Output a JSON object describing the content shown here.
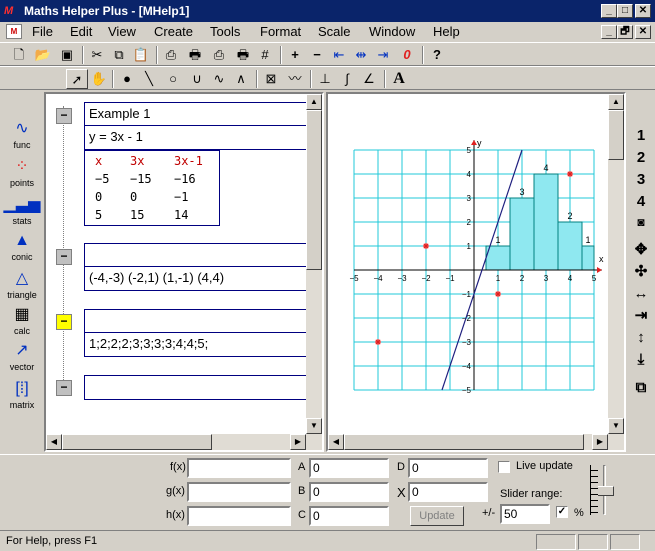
{
  "window": {
    "title": "Maths Helper Plus - [MHelp1]",
    "app_icon": "M",
    "minimize": "_",
    "maximize": "□",
    "close": "✕",
    "restore": "🗗"
  },
  "menu": {
    "items": [
      "File",
      "Edit",
      "View",
      "Create",
      "Tools",
      "Format",
      "Scale",
      "Window",
      "Help"
    ]
  },
  "toolbar1": {
    "icons": [
      "new-document-icon",
      "open-folder-icon",
      "save-icon",
      "cut-icon",
      "copy-icon",
      "paste-icon",
      "print-icon",
      "print-preview-icon",
      "print-graph-icon",
      "print-notes-icon",
      "grid-icon",
      "zoom-in-icon",
      "zoom-out-icon",
      "fit-width-icon",
      "fit-center-icon",
      "fit-right-icon",
      "undo-zoom-icon",
      "help-icon"
    ]
  },
  "toolbar2": {
    "icons": [
      "arrow-pointer-icon",
      "hand-pan-icon",
      "point-icon",
      "line-icon",
      "circle-icon",
      "parabola-icon",
      "curve-icon",
      "peak-icon",
      "intersect-icon",
      "tangent-icon",
      "perpendicular-icon",
      "integral-icon",
      "angle-icon",
      "text-icon"
    ]
  },
  "left_tools": [
    {
      "label": "func",
      "icon": "function-wave-icon"
    },
    {
      "label": "points",
      "icon": "points-icon"
    },
    {
      "label": "stats",
      "icon": "bar-chart-icon"
    },
    {
      "label": "conic",
      "icon": "cone-icon"
    },
    {
      "label": "triangle",
      "icon": "triangle-icon"
    },
    {
      "label": "calc",
      "icon": "calculator-icon"
    },
    {
      "label": "vector",
      "icon": "vector-arrow-icon"
    },
    {
      "label": "matrix",
      "icon": "matrix-icon"
    }
  ],
  "notes": {
    "item1": {
      "title": "Example 1",
      "equation": "y = 3x - 1",
      "node": "−"
    },
    "table": {
      "headers": [
        "x",
        "3x",
        "3x-1"
      ],
      "rows": [
        [
          "−5",
          "−15",
          "−16"
        ],
        [
          "0",
          "0",
          "−1"
        ],
        [
          "5",
          "15",
          "14"
        ]
      ]
    },
    "item2": {
      "title": "",
      "value": "(-4,-3) (-2,1) (1,-1) (4,4)",
      "node": "−"
    },
    "item3": {
      "title": "",
      "value": "1;2;2;2;3;3;3;3;4;4;5;",
      "node": "−"
    },
    "item4": {
      "title": "",
      "node": "−"
    }
  },
  "chart_data": {
    "type": "scatter",
    "title": "",
    "xlabel": "x",
    "ylabel": "y",
    "xlim": [
      -5,
      5
    ],
    "ylim": [
      -5,
      5
    ],
    "grid": true,
    "x_ticks": [
      "−5",
      "−4",
      "−3",
      "−2",
      "−1",
      "1",
      "2",
      "3",
      "4",
      "5"
    ],
    "y_ticks": [
      "5",
      "4",
      "3",
      "2",
      "1",
      "−1",
      "−2",
      "−3",
      "−4",
      "−5"
    ],
    "line": {
      "equation": "y = 3x - 1",
      "slope": 3,
      "intercept": -1,
      "color": "#202080"
    },
    "points": [
      {
        "x": -4,
        "y": -3
      },
      {
        "x": -2,
        "y": 1
      },
      {
        "x": 1,
        "y": -1
      },
      {
        "x": 4,
        "y": 4
      }
    ],
    "point_color": "#e02020",
    "histogram": {
      "bins": [
        {
          "x0": 0.5,
          "x1": 1.5,
          "count": 1
        },
        {
          "x0": 1.5,
          "x1": 2.5,
          "count": 3
        },
        {
          "x0": 2.5,
          "x1": 3.5,
          "count": 4
        },
        {
          "x0": 3.5,
          "x1": 4.5,
          "count": 2
        },
        {
          "x0": 4.5,
          "x1": 5,
          "count": 1
        }
      ],
      "labels": [
        "1",
        "3",
        "4",
        "2",
        "1"
      ],
      "fill": "#8fe8f0",
      "stroke": "#008080"
    },
    "grid_color": "#20c8d8"
  },
  "right_tools": [
    "1",
    "2",
    "3",
    "4",
    "camera-icon",
    "move-icon",
    "compress-icon",
    "expand-horizontal-icon",
    "compress-horizontal-icon",
    "expand-vertical-icon",
    "compress-vertical-icon",
    "copy-graph-icon"
  ],
  "bottom": {
    "fx_label": "f(x)",
    "fx_value": "",
    "gx_label": "g(x)",
    "gx_value": "",
    "hx_label": "h(x)",
    "hx_value": "",
    "a_label": "A",
    "a_value": "0",
    "b_label": "B",
    "b_value": "0",
    "c_label": "C",
    "c_value": "0",
    "d_label": "D",
    "d_value": "0",
    "x_label": "X",
    "x_value": "0",
    "update_label": "Update",
    "live_update_label": "Live update",
    "slider_range_label": "Slider range:",
    "plusminus_label": "+/-",
    "slider_range_value": "50",
    "percent_label": "%"
  },
  "status": {
    "text": "For Help, press F1"
  }
}
